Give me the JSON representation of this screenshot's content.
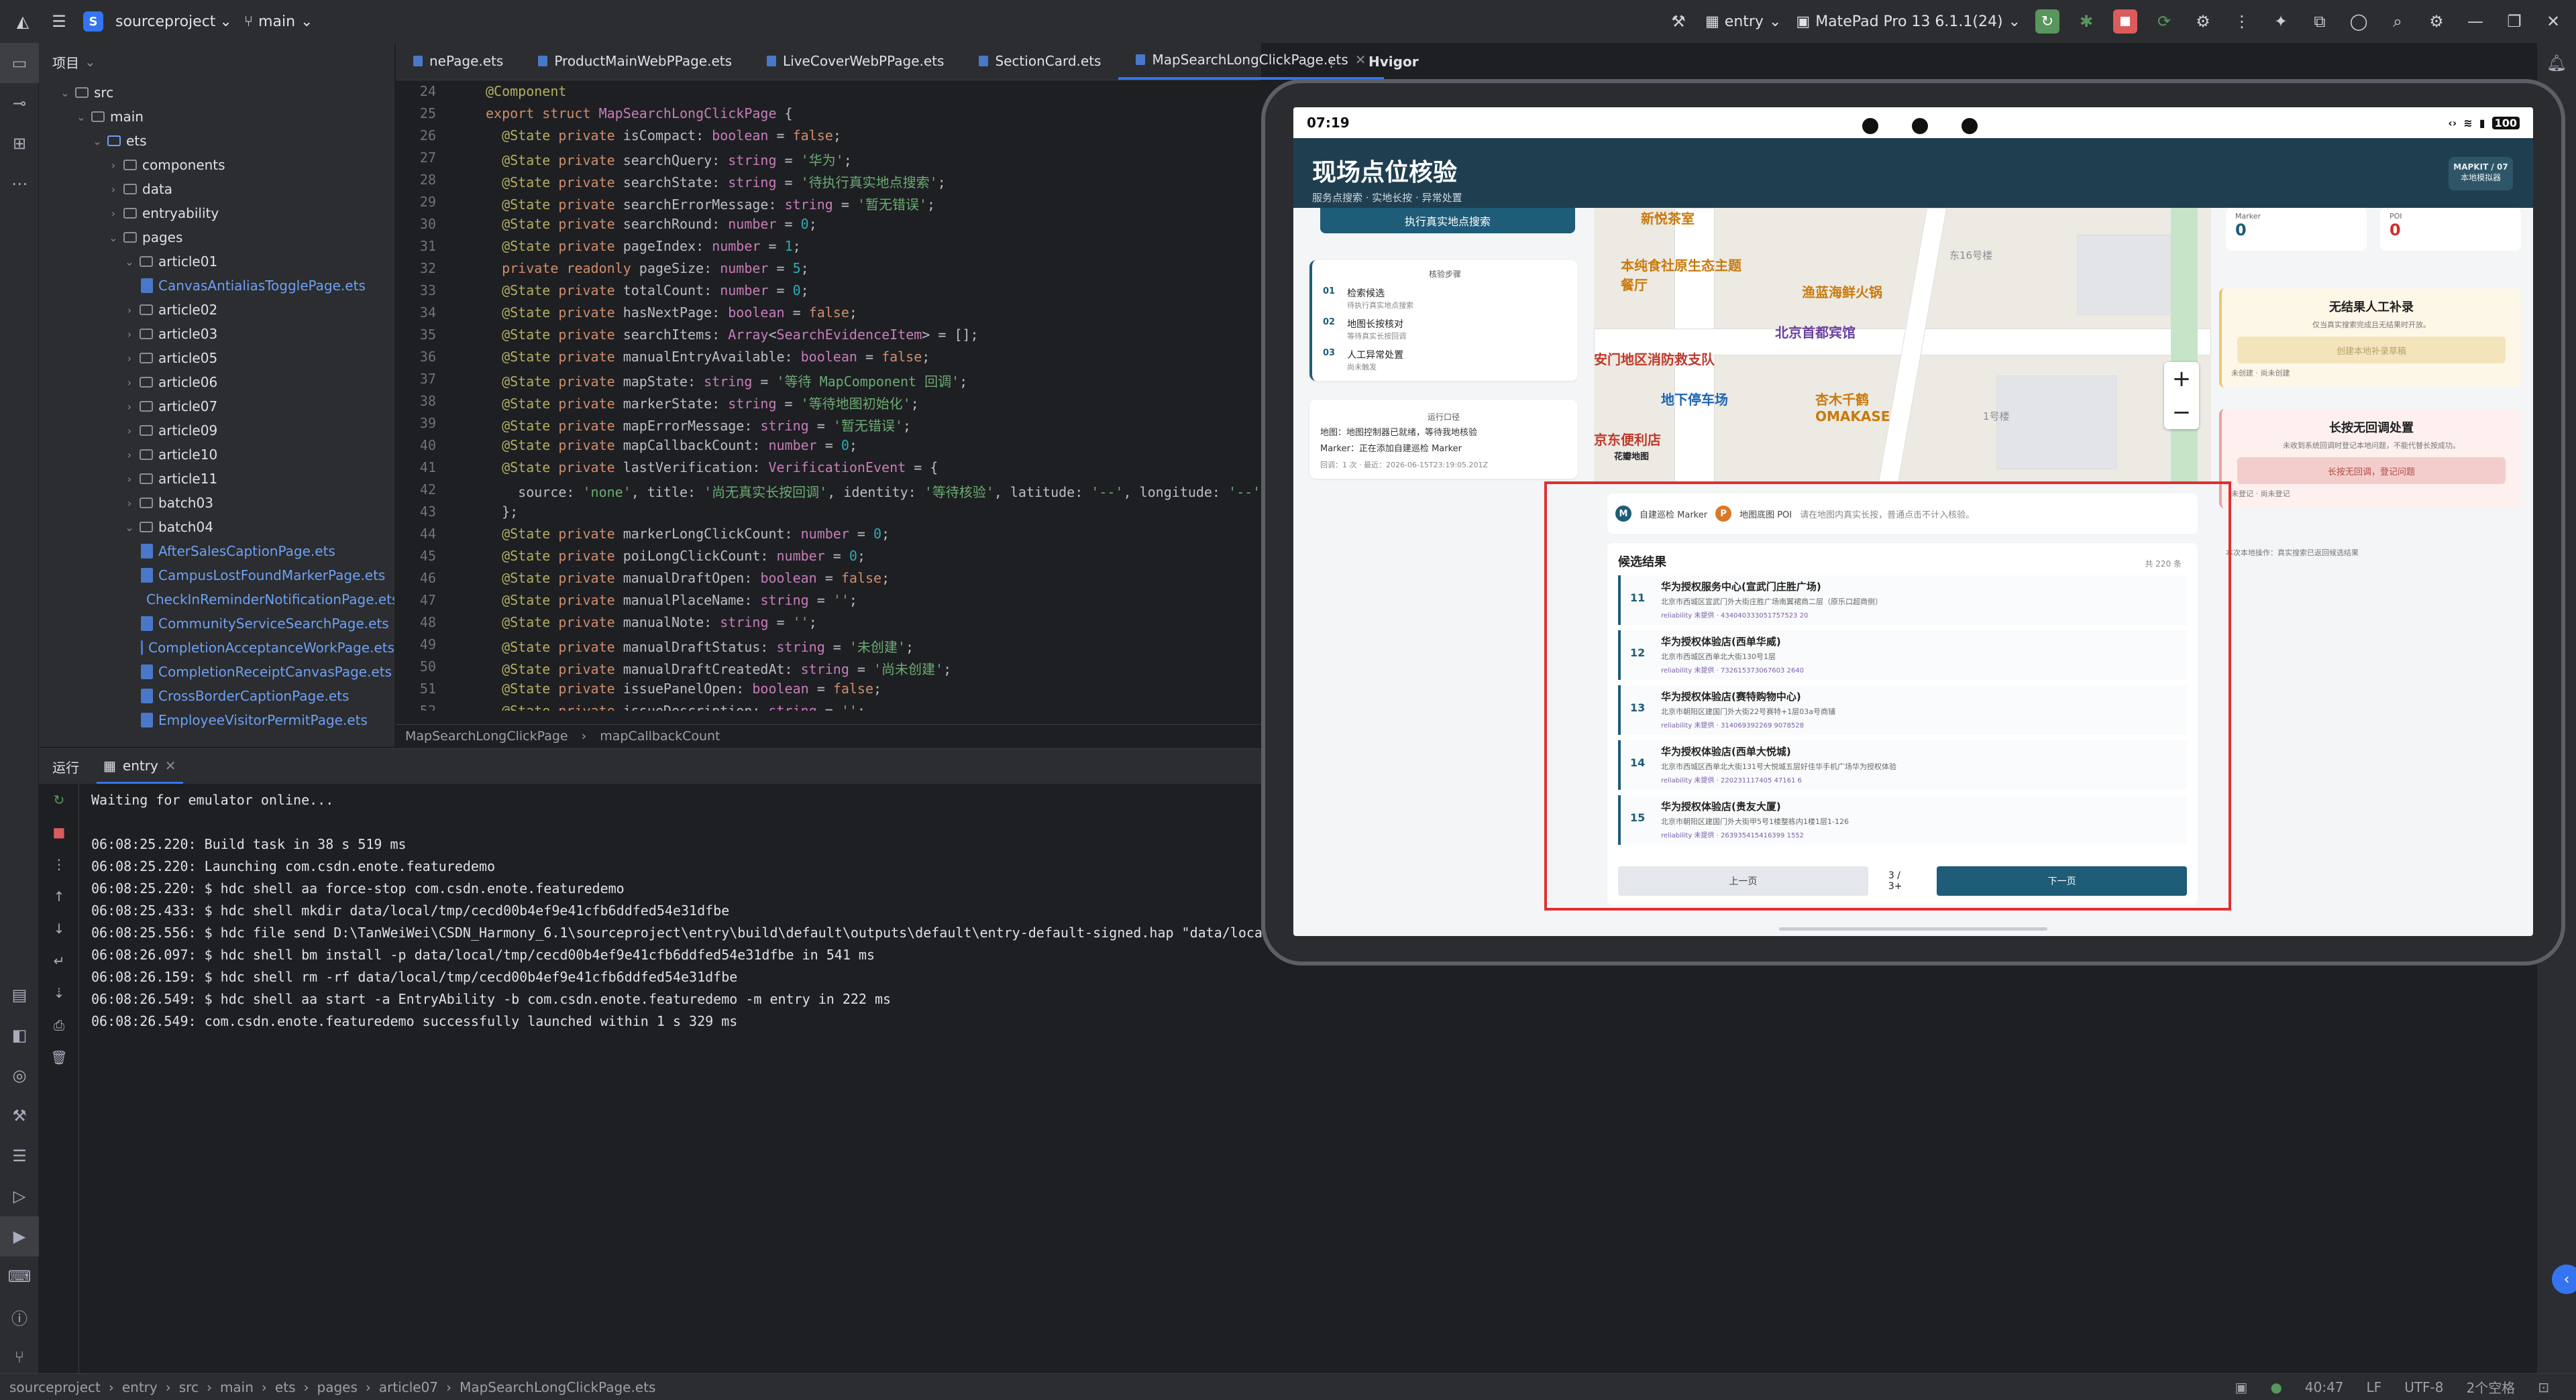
{
  "titlebar": {
    "project_badge": "S",
    "project_name": "sourceproject",
    "branch": "main",
    "run_config": "entry",
    "device": "MatePad Pro 13 6.1.1(24)"
  },
  "project_panel": {
    "title": "项目",
    "tree": [
      {
        "label": "src",
        "indent": 2,
        "type": "folder"
      },
      {
        "label": "main",
        "indent": 3,
        "type": "folder"
      },
      {
        "label": "ets",
        "indent": 4,
        "type": "folder-blue"
      },
      {
        "label": "components",
        "indent": 5,
        "type": "folder"
      },
      {
        "label": "data",
        "indent": 5,
        "type": "folder"
      },
      {
        "label": "entryability",
        "indent": 5,
        "type": "folder"
      },
      {
        "label": "pages",
        "indent": 5,
        "type": "folder"
      },
      {
        "label": "article01",
        "indent": 6,
        "type": "folder"
      },
      {
        "label": "CanvasAntialiasTogglePage.ets",
        "indent": 7,
        "type": "file"
      },
      {
        "label": "article02",
        "indent": 6,
        "type": "folder"
      },
      {
        "label": "article03",
        "indent": 6,
        "type": "folder"
      },
      {
        "label": "article05",
        "indent": 6,
        "type": "folder"
      },
      {
        "label": "article06",
        "indent": 6,
        "type": "folder"
      },
      {
        "label": "article07",
        "indent": 6,
        "type": "folder"
      },
      {
        "label": "article09",
        "indent": 6,
        "type": "folder"
      },
      {
        "label": "article10",
        "indent": 6,
        "type": "folder"
      },
      {
        "label": "article11",
        "indent": 6,
        "type": "folder"
      },
      {
        "label": "batch03",
        "indent": 6,
        "type": "folder"
      },
      {
        "label": "batch04",
        "indent": 6,
        "type": "folder"
      },
      {
        "label": "AfterSalesCaptionPage.ets",
        "indent": 7,
        "type": "file"
      },
      {
        "label": "CampusLostFoundMarkerPage.ets",
        "indent": 7,
        "type": "file"
      },
      {
        "label": "CheckInReminderNotificationPage.ets",
        "indent": 7,
        "type": "file"
      },
      {
        "label": "CommunityServiceSearchPage.ets",
        "indent": 7,
        "type": "file"
      },
      {
        "label": "CompletionAcceptanceWorkPage.ets",
        "indent": 7,
        "type": "file"
      },
      {
        "label": "CompletionReceiptCanvasPage.ets",
        "indent": 7,
        "type": "file"
      },
      {
        "label": "CrossBorderCaptionPage.ets",
        "indent": 7,
        "type": "file"
      },
      {
        "label": "EmployeeVisitorPermitPage.ets",
        "indent": 7,
        "type": "file"
      }
    ]
  },
  "editor": {
    "tabs": [
      "nePage.ets",
      "ProductMainWebPPage.ets",
      "LiveCoverWebPPage.ets",
      "SectionCard.ets",
      "MapSearchLongClickPage.ets"
    ],
    "active_tab": 4,
    "hvigor_label": "Hvigor",
    "breadcrumb": [
      "MapSearchLongClickPage",
      "mapCallbackCount"
    ],
    "first_line": 24,
    "lines": [
      "@Component",
      "export struct MapSearchLongClickPage {",
      "  @State private isCompact: boolean = false;",
      "  @State private searchQuery: string = '华为';",
      "  @State private searchState: string = '待执行真实地点搜索';",
      "  @State private searchErrorMessage: string = '暂无错误';",
      "  @State private searchRound: number = 0;",
      "  @State private pageIndex: number = 1;",
      "  private readonly pageSize: number = 5;",
      "  @State private totalCount: number = 0;",
      "  @State private hasNextPage: boolean = false;",
      "  @State private searchItems: Array<SearchEvidenceItem> = [];",
      "  @State private manualEntryAvailable: boolean = false;",
      "  @State private mapState: string = '等待 MapComponent 回调';",
      "  @State private markerState: string = '等待地图初始化';",
      "  @State private mapErrorMessage: string = '暂无错误';",
      "  @State private mapCallbackCount: number = 0;",
      "  @State private lastVerification: VerificationEvent = {",
      "    source: 'none', title: '尚无真实长按回调', identity: '等待核验', latitude: '--', longitude: '--',",
      "  };",
      "  @State private markerLongClickCount: number = 0;",
      "  @State private poiLongClickCount: number = 0;",
      "  @State private manualDraftOpen: boolean = false;",
      "  @State private manualPlaceName: string = '';",
      "  @State private manualNote: string = '';",
      "  @State private manualDraftStatus: string = '未创建';",
      "  @State private manualDraftCreatedAt: string = '尚未创建';",
      "  @State private issuePanelOpen: boolean = false;",
      "  @State private issueDescription: string = '';"
    ]
  },
  "run_panel": {
    "label": "运行",
    "tab": "entry",
    "console": [
      "Waiting for emulator online...",
      "",
      "06:08:25.220: Build task in 38 s 519 ms",
      "06:08:25.220: Launching com.csdn.enote.featuredemo",
      "06:08:25.220: $ hdc shell aa force-stop com.csdn.enote.featuredemo",
      "06:08:25.433: $ hdc shell mkdir data/local/tmp/cecd00b4ef9e41cfb6ddfed54e31dfbe",
      "06:08:25.556: $ hdc file send D:\\TanWeiWei\\CSDN_Harmony_6.1\\sourceproject\\entry\\build\\default\\outputs\\default\\entry-default-signed.hap \"data/local/tmp/cecd00b4ef9e41cfb6ddfed54e31dfbe\" in 125 ms",
      "06:08:26.097: $ hdc shell bm install -p data/local/tmp/cecd00b4ef9e41cfb6ddfed54e31dfbe in 541 ms",
      "06:08:26.159: $ hdc shell rm -rf data/local/tmp/cecd00b4ef9e41cfb6ddfed54e31dfbe",
      "06:08:26.549: $ hdc shell aa start -a EntryAbility -b com.csdn.enote.featuredemo -m entry in 222 ms",
      "06:08:26.549: com.csdn.enote.featuredemo successfully launched within 1 s 329 ms"
    ]
  },
  "statusbar": {
    "path": [
      "sourceproject",
      "entry",
      "src",
      "main",
      "ets",
      "pages",
      "article07",
      "MapSearchLongClickPage.ets"
    ],
    "position": "40:47",
    "line_ending": "LF",
    "encoding": "UTF-8",
    "indent": "2个空格"
  },
  "device": {
    "time": "07:19",
    "battery": "100",
    "app_title": "现场点位核验",
    "app_subtitle": "服务点搜索 · 实地长按 · 异常处置",
    "header_badge_line1": "MAPKIT / 07",
    "header_badge_line2": "本地模拟器",
    "exec_button": "执行真实地点搜索",
    "steps_title": "核验步骤",
    "steps": [
      {
        "no": "01",
        "title": "检索候选",
        "desc": "待执行真实地点搜索"
      },
      {
        "no": "02",
        "title": "地图长按核对",
        "desc": "等待真实长按回调"
      },
      {
        "no": "03",
        "title": "人工异常处置",
        "desc": "尚未触发"
      }
    ],
    "callback_title": "运行口径",
    "callback_map": "地图：地图控制器已就绪，等待我地核验",
    "callback_marker": "Marker：正在添加自建巡检 Marker",
    "callback_round": "回调：1 次 · 最近：2026-06-15T23:19:05.201Z",
    "map_pois": [
      {
        "label": "新悦茶室",
        "color": "o"
      },
      {
        "label": "本纯食社原生态主题餐厅",
        "color": "o"
      },
      {
        "label": "渔蓝海鲜火锅",
        "color": "o"
      },
      {
        "label": "北京首都宾馆",
        "color": "p"
      },
      {
        "label": "安门地区消防救支队",
        "color": "r"
      },
      {
        "label": "地下停车场",
        "color": "b"
      },
      {
        "label": "杏木千鹤 OMAKASE",
        "color": "o"
      },
      {
        "label": "京东便利店",
        "color": "r"
      },
      {
        "label": "东16号楼",
        "color": "g"
      },
      {
        "label": "1号楼",
        "color": "g"
      },
      {
        "label": "花瓣地图",
        "color": "k"
      }
    ],
    "zoom_in": "+",
    "zoom_out": "−",
    "stats": [
      {
        "label": "Marker",
        "value": "0"
      },
      {
        "label": "POI",
        "value": "0"
      }
    ],
    "manual_card_title": "无结果人工补录",
    "manual_card_desc": "仅当真实搜索完成且无结果时开放。",
    "manual_card_button": "创建本地补录草稿",
    "manual_card_status": "未创建 · 尚未创建",
    "issue_card_title": "长按无回调处置",
    "issue_card_desc": "未收到系统回调时登记本地问题，不能代替长按成功。",
    "issue_card_button": "长按无回调，登记问题",
    "issue_card_status": "未登记 · 尚未登记",
    "right_footer": "本次本地操作：真实搜索已返回候选结果",
    "legend_m": "M",
    "legend_m_label": "自建巡检 Marker",
    "legend_p": "P",
    "legend_p_label": "地图底图 POI",
    "legend_hint": "请在地图内真实长按，普通点击不计入核验。",
    "results_title": "候选结果",
    "results_total": "共 220 条",
    "results": [
      {
        "idx": "11",
        "name": "华为授权服务中心(宣武门庄胜广场)",
        "addr": "北京市西城区宣武门外大街庄胜广场南翼裙商二层（原乐口超商侧）",
        "rel": "reliability 未提供 · 434040333051757523 20"
      },
      {
        "idx": "12",
        "name": "华为授权体验店(西单华威)",
        "addr": "北京市西城区西单北大街130号1层",
        "rel": "reliability 未提供 · 732615373067603 2640"
      },
      {
        "idx": "13",
        "name": "华为授权体验店(赛特购物中心)",
        "addr": "北京市朝阳区建国门外大街22号赛特+1层03a号商铺",
        "rel": "reliability 未提供 · 314069392269 9078528"
      },
      {
        "idx": "14",
        "name": "华为授权体验店(西单大悦城)",
        "addr": "北京市西城区西单北大街131号大悦城五层好佳华手机广场华为授权体验",
        "rel": "reliability 未提供 · 220231117405 47161 6"
      },
      {
        "idx": "15",
        "name": "华为授权体验店(贵友大厦)",
        "addr": "北京市朝阳区建国门外大街甲5号1楼整栋内1楼1层1-126",
        "rel": "reliability 未提供 · 263935415416399 1552"
      }
    ],
    "prev_label": "上一页",
    "page_label": "3 / 3+",
    "next_label": "下一页"
  },
  "colors": {
    "accent": "#3574f0",
    "app_header": "#1f3f50",
    "app_primary": "#1e5c78",
    "highlight_box": "#e03030"
  }
}
